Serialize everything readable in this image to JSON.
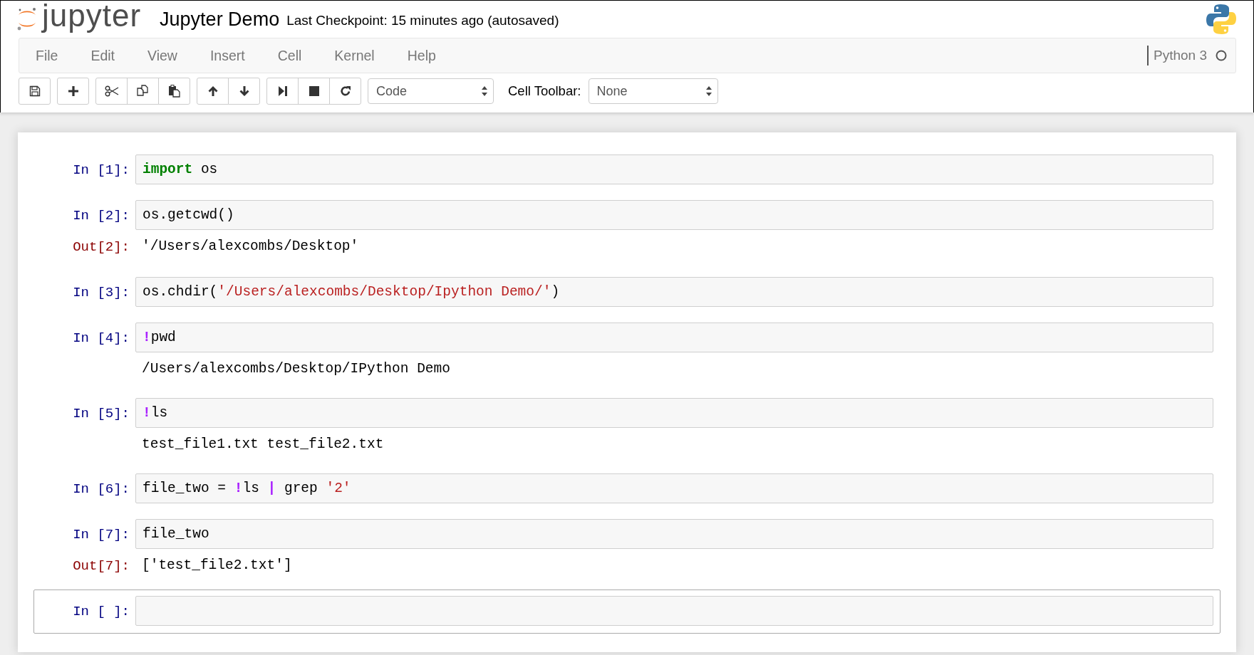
{
  "header": {
    "logo_text": "jupyter",
    "notebook_name": "Jupyter Demo",
    "checkpoint": "Last Checkpoint: 15 minutes ago (autosaved)"
  },
  "menu": [
    "File",
    "Edit",
    "View",
    "Insert",
    "Cell",
    "Kernel",
    "Help"
  ],
  "kernel": {
    "name": "Python 3",
    "busy": false
  },
  "toolbar": {
    "cell_type": "Code",
    "cell_toolbar_label": "Cell Toolbar:",
    "cell_toolbar_value": "None"
  },
  "cells": [
    {
      "prompt": "In [1]:",
      "selected": false,
      "code": [
        {
          "kind": "keyword",
          "text": "import"
        },
        {
          "kind": "plain",
          "text": " os"
        }
      ]
    },
    {
      "prompt": "In [2]:",
      "selected": false,
      "code": [
        {
          "kind": "plain",
          "text": "os.getcwd()"
        }
      ],
      "output": {
        "prompt": "Out[2]:",
        "text": "'/Users/alexcombs/Desktop'"
      }
    },
    {
      "prompt": "In [3]:",
      "selected": false,
      "code": [
        {
          "kind": "plain",
          "text": "os.chdir("
        },
        {
          "kind": "string",
          "text": "'/Users/alexcombs/Desktop/Ipython Demo/'"
        },
        {
          "kind": "plain",
          "text": ")"
        }
      ]
    },
    {
      "prompt": "In [4]:",
      "selected": false,
      "code": [
        {
          "kind": "magic",
          "text": "!"
        },
        {
          "kind": "plain",
          "text": "pwd"
        }
      ],
      "output": {
        "text": "/Users/alexcombs/Desktop/IPython Demo"
      }
    },
    {
      "prompt": "In [5]:",
      "selected": false,
      "code": [
        {
          "kind": "magic",
          "text": "!"
        },
        {
          "kind": "plain",
          "text": "ls"
        }
      ],
      "output": {
        "text": "test_file1.txt test_file2.txt"
      }
    },
    {
      "prompt": "In [6]:",
      "selected": false,
      "code": [
        {
          "kind": "plain",
          "text": "file_two = "
        },
        {
          "kind": "magic",
          "text": "!"
        },
        {
          "kind": "plain",
          "text": "ls "
        },
        {
          "kind": "magic",
          "text": "|"
        },
        {
          "kind": "plain",
          "text": " grep "
        },
        {
          "kind": "string",
          "text": "'2'"
        }
      ]
    },
    {
      "prompt": "In [7]:",
      "selected": false,
      "code": [
        {
          "kind": "plain",
          "text": "file_two"
        }
      ],
      "output": {
        "prompt": "Out[7]:",
        "text": "['test_file2.txt']"
      }
    },
    {
      "prompt": "In [ ]:",
      "selected": true
    }
  ]
}
